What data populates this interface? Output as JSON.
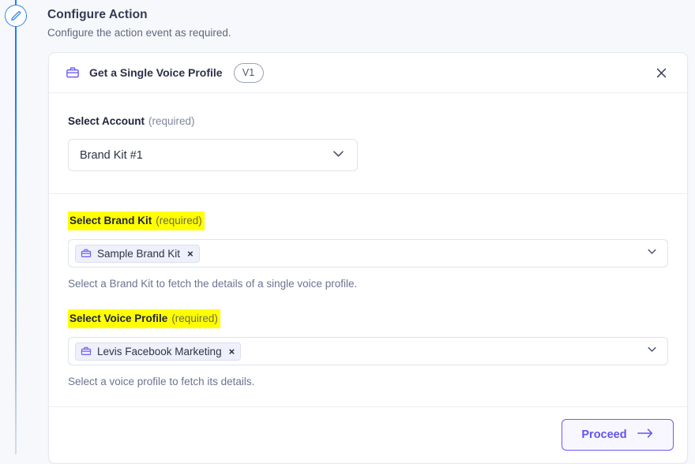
{
  "rail": {
    "icon": "pencil-edit-icon"
  },
  "page": {
    "title": "Configure Action",
    "subtitle": "Configure the action event as required."
  },
  "card": {
    "icon": "briefcase-icon",
    "title": "Get a Single Voice Profile",
    "version_badge": "V1",
    "close_icon": "close-icon"
  },
  "account_section": {
    "label": "Select Account",
    "required_text": "(required)",
    "selected_value": "Brand Kit #1",
    "chevron_icon": "chevron-down-icon"
  },
  "brand_kit_section": {
    "label": "Select Brand Kit",
    "required_text": "(required)",
    "highlighted": true,
    "chip": {
      "icon": "briefcase-icon",
      "label": "Sample Brand Kit",
      "remove_icon": "×"
    },
    "helper_text": "Select a Brand Kit to fetch the details of a single voice profile.",
    "chevron_icon": "chevron-down-icon"
  },
  "voice_profile_section": {
    "label": "Select Voice Profile",
    "required_text": "(required)",
    "highlighted": true,
    "chip": {
      "icon": "briefcase-icon",
      "label": "Levis Facebook Marketing",
      "remove_icon": "×"
    },
    "helper_text": "Select a voice profile to fetch its details.",
    "chevron_icon": "chevron-down-icon"
  },
  "footer": {
    "proceed_label": "Proceed",
    "arrow_icon": "arrow-right-icon"
  },
  "colors": {
    "accent_purple": "#6155ef",
    "rail_blue": "#1e7ef0",
    "highlight_yellow": "#ffff00",
    "page_bg": "#f7f8fb",
    "card_bg": "#ffffff"
  }
}
